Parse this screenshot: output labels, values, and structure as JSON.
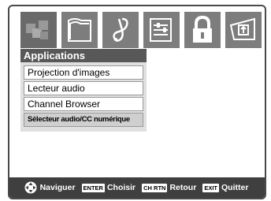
{
  "menu": {
    "title": "Applications",
    "items": [
      {
        "label": "Projection d'images",
        "selected": false
      },
      {
        "label": "Lecteur audio",
        "selected": false
      },
      {
        "label": "Channel Browser",
        "selected": false
      },
      {
        "label": "Sélecteur audio/CC numérique",
        "selected": true
      }
    ]
  },
  "iconbar": {
    "icons": [
      "applications-icon",
      "picture-icon",
      "audio-icon",
      "setup-icon",
      "lock-icon",
      "preferences-icon"
    ]
  },
  "footer": {
    "navigate_label": "Naviguer",
    "enter_key": "ENTER",
    "choose_label": "Choisir",
    "return_key": "CH RTN",
    "return_label": "Retour",
    "exit_key": "EXIT",
    "exit_label": "Quitter"
  },
  "colors": {
    "tile": "#7d7d7d",
    "title_bar": "#585858",
    "menu_bg": "#e0e0e0",
    "footer_bg": "#3f3f3f"
  }
}
